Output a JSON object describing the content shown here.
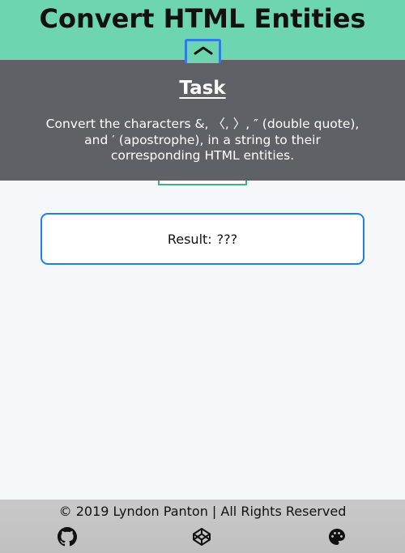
{
  "header": {
    "title": "Convert HTML Entities",
    "toggle_icon": "chevron-up-icon"
  },
  "task": {
    "heading": "Task",
    "description": "Convert the characters &, 〈, 〉, ″ (double quote), and ′ (apostrophe), in a string to their corresponding HTML entities."
  },
  "result": {
    "label": "Result:",
    "value": "???"
  },
  "footer": {
    "copyright": "© 2019 Lyndon Panton | All Rights Reserved",
    "icons": [
      "github-icon",
      "codepen-icon",
      "palette-icon"
    ]
  },
  "colors": {
    "header_bg": "#6dd6b1",
    "task_bg": "#5e6266",
    "result_border": "#1f7ee8",
    "toggle_border": "#2f7de1",
    "footer_bg": "#c4c4c4"
  }
}
